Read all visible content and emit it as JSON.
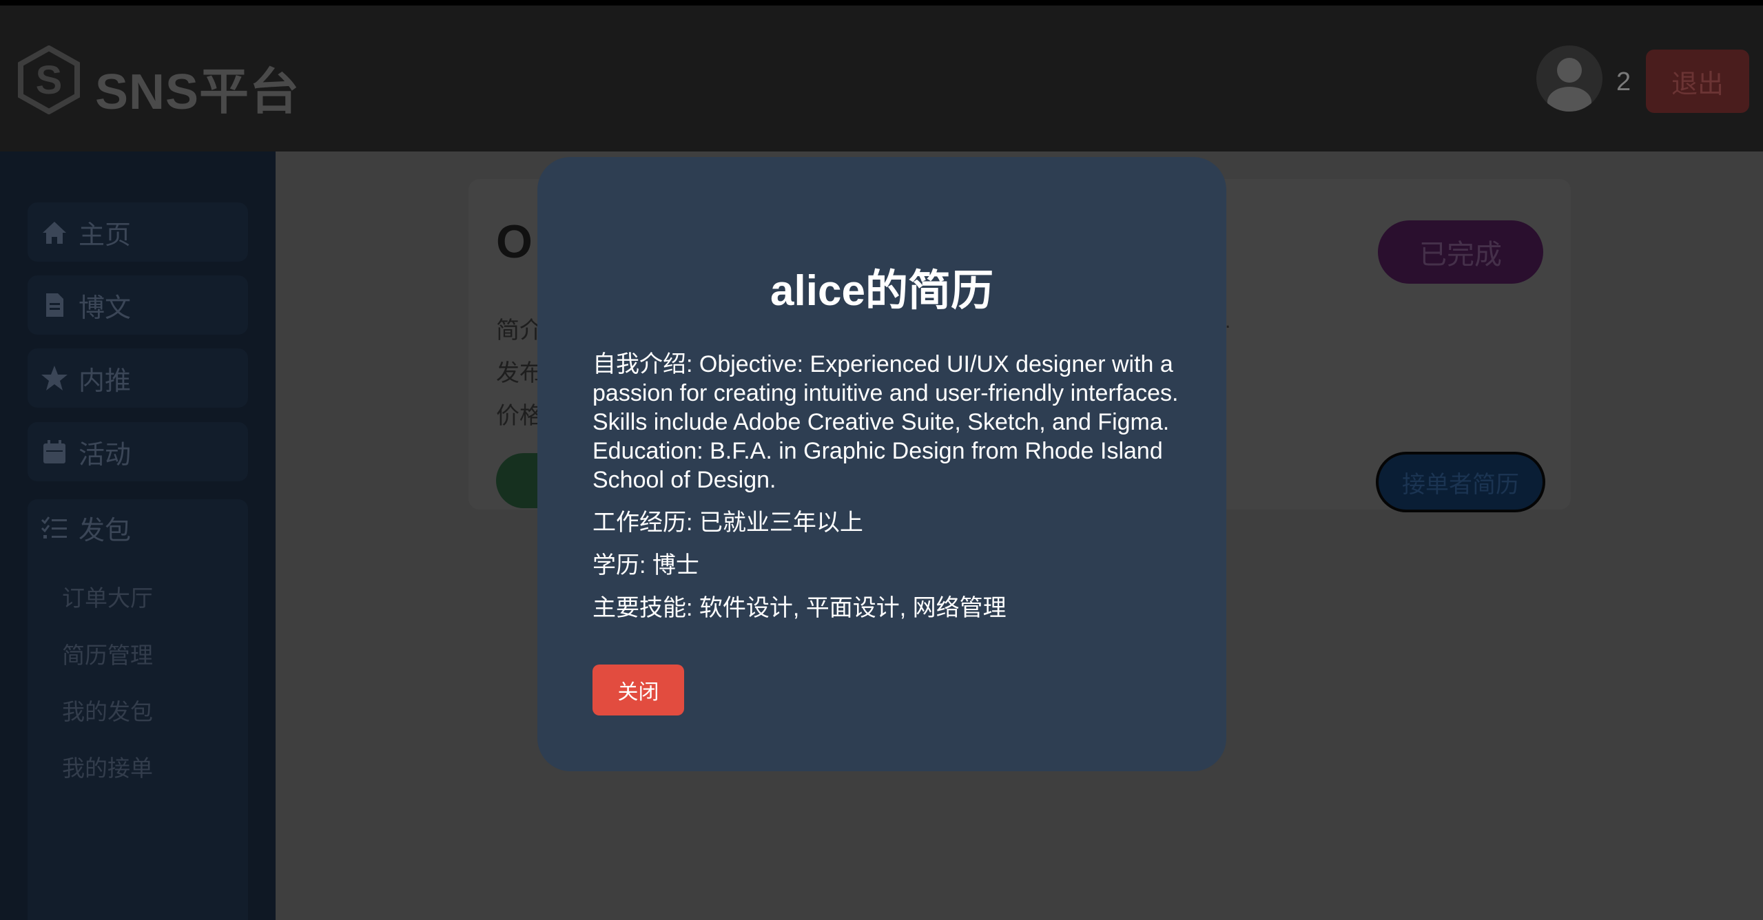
{
  "header": {
    "brand": "SNS平台",
    "user_count": "2",
    "logout_label": "退出"
  },
  "sidebar": {
    "items": [
      {
        "label": "主页",
        "icon": "home-icon"
      },
      {
        "label": "博文",
        "icon": "document-icon"
      },
      {
        "label": "内推",
        "icon": "star-icon"
      },
      {
        "label": "活动",
        "icon": "calendar-icon"
      }
    ],
    "submenu": {
      "label": "发包",
      "icon": "checklist-icon",
      "items": [
        "订单大厅",
        "简历管理",
        "我的发包",
        "我的接单"
      ]
    }
  },
  "card": {
    "title_partial": "O",
    "line1_partial": "简介",
    "line2_partial": "发布",
    "line3_partial": "价格",
    "trailing_dot": ".",
    "status_label": "已完成",
    "resume_button_label": "接单者简历"
  },
  "modal": {
    "title": "alice的简历",
    "intro": "自我介绍: Objective: Experienced UI/UX designer with a passion for creating intuitive and user-friendly interfaces. Skills include Adobe Creative Suite, Sketch, and Figma. Education: B.F.A. in Graphic Design from Rhode Island School of Design.",
    "experience": "工作经历: 已就业三年以上",
    "education": "学历: 博士",
    "skills": "主要技能: 软件设计, 平面设计, 网络管理",
    "close_label": "关闭"
  },
  "colors": {
    "modal_bg": "#2e3e52",
    "close_button": "#e24c3f",
    "header_bg": "#1a1a1a",
    "sidebar_bg": "#0f1824"
  }
}
